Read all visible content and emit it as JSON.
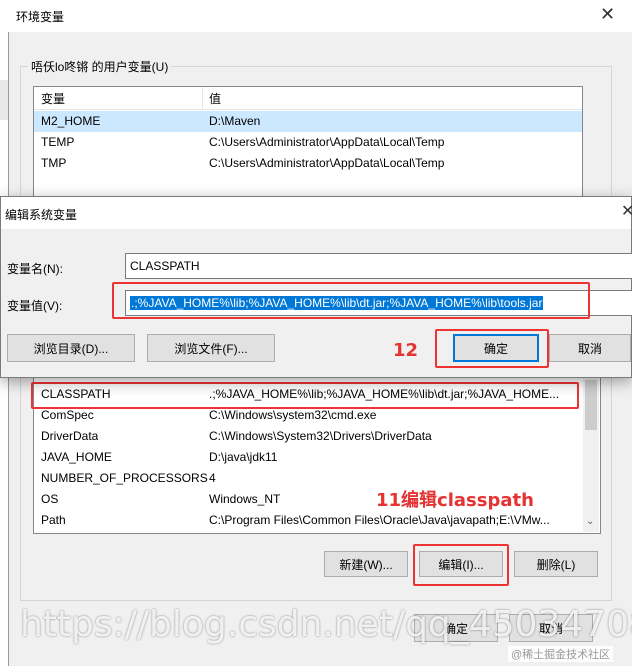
{
  "env_window": {
    "title": "环境变量",
    "user_group_label": "唔仸lo咚锵 的用户变量(U)",
    "columns": {
      "name": "变量",
      "value": "值"
    },
    "user_vars": [
      {
        "name": "M2_HOME",
        "value": "D:\\Maven"
      },
      {
        "name": "TEMP",
        "value": "C:\\Users\\Administrator\\AppData\\Local\\Temp"
      },
      {
        "name": "TMP",
        "value": "C:\\Users\\Administrator\\AppData\\Local\\Temp"
      }
    ],
    "system_vars": [
      {
        "name": "CLASSPATH",
        "value": ".;%JAVA_HOME%\\lib;%JAVA_HOME%\\lib\\dt.jar;%JAVA_HOME..."
      },
      {
        "name": "ComSpec",
        "value": "C:\\Windows\\system32\\cmd.exe"
      },
      {
        "name": "DriverData",
        "value": "C:\\Windows\\System32\\Drivers\\DriverData"
      },
      {
        "name": "JAVA_HOME",
        "value": "D:\\java\\jdk11"
      },
      {
        "name": "NUMBER_OF_PROCESSORS",
        "value": "4"
      },
      {
        "name": "OS",
        "value": "Windows_NT"
      },
      {
        "name": "Path",
        "value": "C:\\Program Files\\Common Files\\Oracle\\Java\\javapath;E:\\VMw..."
      }
    ],
    "buttons": {
      "new": "新建(W)...",
      "edit": "编辑(I)...",
      "delete": "删除(L)",
      "ok": "确定",
      "cancel": "取消"
    }
  },
  "dialog": {
    "title": "编辑系统变量",
    "name_label": "变量名(N):",
    "name_value": "CLASSPATH",
    "value_label": "变量值(V):",
    "value_value": ".;%JAVA_HOME%\\lib;%JAVA_HOME%\\lib\\dt.jar;%JAVA_HOME%\\lib\\tools.jar",
    "buttons": {
      "browse_dir": "浏览目录(D)...",
      "browse_file": "浏览文件(F)...",
      "ok": "确定",
      "cancel": "取消"
    }
  },
  "annotations": {
    "step12": "12",
    "step11": "11编辑classpath"
  },
  "watermark": {
    "main": "https://blog.csdn.net/qq_45034708",
    "corner": "@稀土掘金技术社区"
  },
  "colors": {
    "annotation": "#e53333",
    "selection": "#0078d7"
  }
}
